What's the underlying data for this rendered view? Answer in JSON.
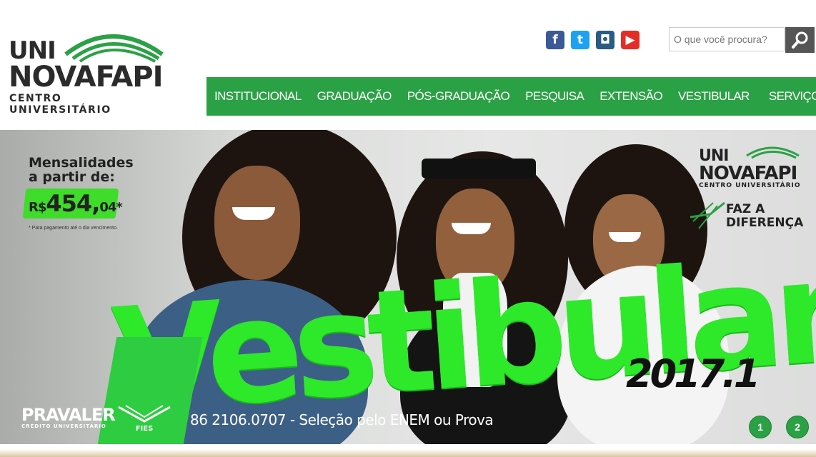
{
  "logo": {
    "line1": "UNI",
    "line2": "NOVAFAPI",
    "tagline": "CENTRO UNIVERSITÁRIO"
  },
  "social": [
    {
      "icon": "facebook-icon",
      "glyph": "f",
      "color": "#3b5998"
    },
    {
      "icon": "twitter-icon",
      "glyph": "t",
      "color": "#1da1f2"
    },
    {
      "icon": "instagram-icon",
      "glyph": "◘",
      "color": "#2a5b84"
    },
    {
      "icon": "youtube-icon",
      "glyph": "▶",
      "color": "#e52d27"
    }
  ],
  "search": {
    "placeholder": "O que você procura?"
  },
  "nav": {
    "items": [
      "INSTITUCIONAL",
      "GRADUAÇÃO",
      "PÓS-GRADUAÇÃO",
      "PESQUISA",
      "EXTENSÃO",
      "VESTIBULAR",
      "SERVIÇOS"
    ],
    "color": "#2ba145"
  },
  "banner": {
    "promo_line1": "Mensalidades",
    "promo_line2": "a partir de:",
    "price_currency": "R$",
    "price_main": "454,",
    "price_cents": "04",
    "price_mark": "*",
    "note": "* Para pagamento até o dia vencimento.",
    "headline": "Vestibular",
    "year": "2017.1",
    "right_logo_line1": "UNI",
    "right_logo_line2": "NOVAFAPI",
    "right_logo_line3": "CENTRO UNIVERSITÁRIO",
    "slogan_line1": "FAZ A",
    "slogan_line2": "DIFERENÇA",
    "pravaler": "PRAVALER",
    "pravaler_sub": "CRÉDITO UNIVERSITÁRIO",
    "fies": "FIES",
    "contact": "86 2106.0707  -  Seleção pelo ENEM ou Prova",
    "slides": [
      "1",
      "2"
    ]
  }
}
